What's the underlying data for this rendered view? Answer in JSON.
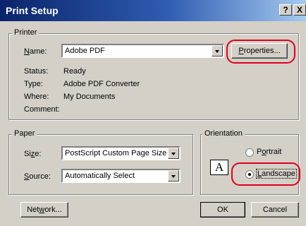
{
  "window": {
    "title": "Print Setup",
    "help_glyph": "?",
    "close_glyph": "X"
  },
  "printer": {
    "legend": "Printer",
    "name_label_key": "N",
    "name_label_rest": "ame:",
    "name_value": "Adobe PDF",
    "properties_key": "P",
    "properties_rest": "roperties...",
    "status_label": "Status:",
    "status_value": "Ready",
    "type_label": "Type:",
    "type_value": "Adobe PDF Converter",
    "where_label": "Where:",
    "where_value": "My Documents",
    "comment_label": "Comment:"
  },
  "paper": {
    "legend": "Paper",
    "size_label_pre": "Si",
    "size_label_key": "z",
    "size_label_post": "e:",
    "size_value": "PostScript Custom Page Size",
    "source_label_key": "S",
    "source_label_rest": "ource:",
    "source_value": "Automatically Select"
  },
  "orientation": {
    "legend": "Orientation",
    "portrait_pre": "P",
    "portrait_key": "o",
    "portrait_post": "rtrait",
    "landscape_key": "L",
    "landscape_rest": "andscape",
    "selected": "landscape",
    "icon_letter": "A"
  },
  "buttons": {
    "network_pre": "Net",
    "network_key": "w",
    "network_post": "ork...",
    "ok": "OK",
    "cancel": "Cancel"
  },
  "colors": {
    "title_start": "#0a246a",
    "title_end": "#a6caf0",
    "face": "#d4d0c8",
    "highlight_marker": "#e0001b"
  }
}
